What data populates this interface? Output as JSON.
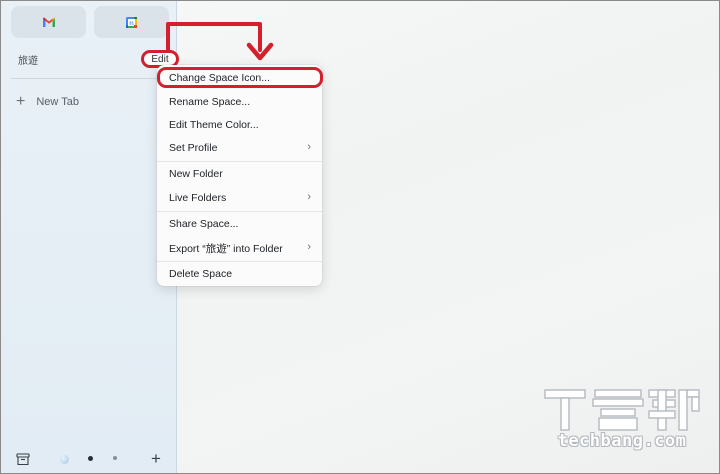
{
  "sidebar": {
    "pinned_tabs": [
      {
        "name": "Gmail",
        "icon": "gmail-icon"
      },
      {
        "name": "Google Calendar",
        "icon": "calendar-icon"
      }
    ],
    "space_name": "旅遊",
    "edit_label": "Edit",
    "new_tab_label": "New Tab",
    "bottom_bar": {
      "archive_icon": "archive-icon",
      "add_icon": "plus-icon"
    }
  },
  "menu": {
    "items": [
      {
        "label": "Change Space Icon...",
        "submenu": false
      },
      {
        "label": "Rename Space...",
        "submenu": false
      },
      {
        "label": "Edit Theme Color...",
        "submenu": false
      },
      {
        "label": "Set Profile",
        "submenu": true
      },
      {
        "label": "New Folder",
        "submenu": false
      },
      {
        "label": "Live Folders",
        "submenu": true
      },
      {
        "label": "Share Space...",
        "submenu": false
      },
      {
        "label": "Export “旅遊” into Folder",
        "submenu": true
      },
      {
        "label": "Delete Space",
        "submenu": false
      }
    ]
  },
  "annotation": {
    "highlight_color": "#d4202c"
  },
  "watermark": {
    "brand": "T客邦",
    "domain": "techbang.com"
  },
  "colors": {
    "sidebar_bg": "#e6eff6",
    "accent_red": "#d4202c"
  }
}
